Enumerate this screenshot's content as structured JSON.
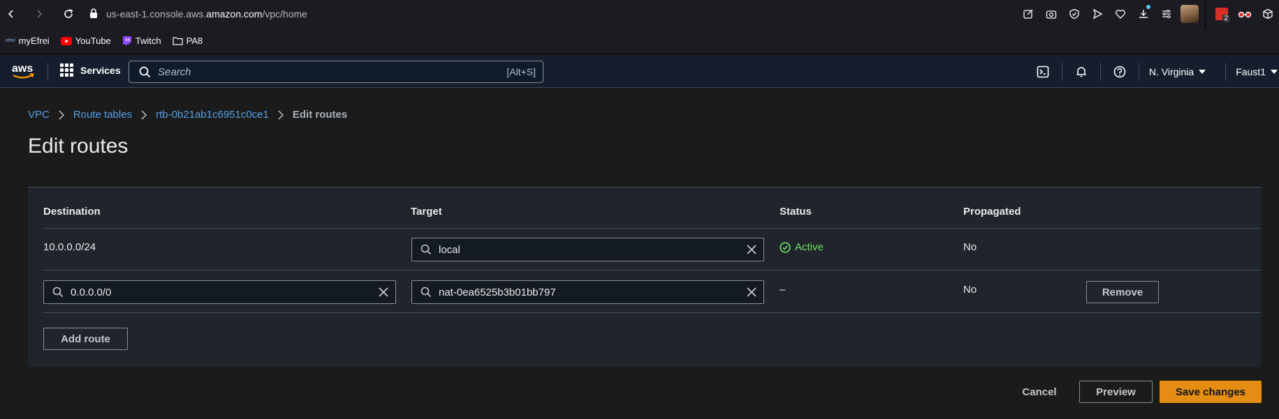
{
  "browser": {
    "url_prefix": "us-east-1.console.aws.",
    "url_domain": "amazon.com",
    "url_suffix": "/vpc/home",
    "ext_badge": "2"
  },
  "bookmarks": [
    {
      "label": "myEfrei",
      "icon": "efrei-icon"
    },
    {
      "label": "YouTube",
      "icon": "youtube-icon"
    },
    {
      "label": "Twitch",
      "icon": "twitch-icon"
    },
    {
      "label": "PA8",
      "icon": "folder-icon"
    }
  ],
  "aws_nav": {
    "logo": "aws",
    "services_label": "Services",
    "search_placeholder": "Search",
    "search_shortcut": "[Alt+S]",
    "region": "N. Virginia",
    "account": "Faust1"
  },
  "breadcrumb": {
    "vpc": "VPC",
    "route_tables": "Route tables",
    "rtb_id": "rtb-0b21ab1c6951c0ce1",
    "current": "Edit routes"
  },
  "page_title": "Edit routes",
  "table": {
    "headers": {
      "destination": "Destination",
      "target": "Target",
      "status": "Status",
      "propagated": "Propagated"
    },
    "rows": [
      {
        "destination": "10.0.0.0/24",
        "target": "local",
        "status": "Active",
        "propagated": "No"
      },
      {
        "destination": "0.0.0.0/0",
        "target": "nat-0ea6525b3b01bb797",
        "status": "–",
        "propagated": "No",
        "remove_label": "Remove"
      }
    ],
    "add_route_label": "Add route"
  },
  "footer": {
    "cancel": "Cancel",
    "preview": "Preview",
    "save": "Save changes"
  },
  "colors": {
    "accent_link": "#539fe5",
    "save_button": "#e58c12",
    "status_active": "#6ee063"
  }
}
